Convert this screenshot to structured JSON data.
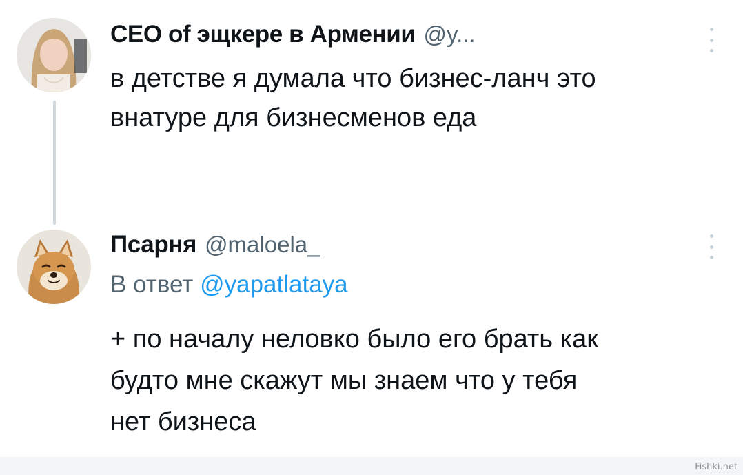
{
  "tweets": [
    {
      "display_name": "СЕО of эщкере в Армении",
      "handle": "@y...",
      "avatar_icon": "woman-portrait-avatar",
      "body_lines": [
        "в детстве я думала что бизнес-ланч это",
        "внатуре для бизнесменов еда"
      ]
    },
    {
      "display_name": "Псарня",
      "handle": "@maloela_",
      "avatar_icon": "shiba-dog-avatar",
      "reply_prefix": "В ответ",
      "reply_mention": "@yapatlataya",
      "body_lines": [
        "+ по началу неловко было его брать как",
        "будто мне скажут мы знаем что у тебя",
        "нет бизнеса"
      ]
    }
  ],
  "colors": {
    "text": "#0f1419",
    "secondary": "#536471",
    "mention": "#1d9bf0",
    "thread_line": "#cfd9de"
  },
  "watermark": "Fishki.net"
}
